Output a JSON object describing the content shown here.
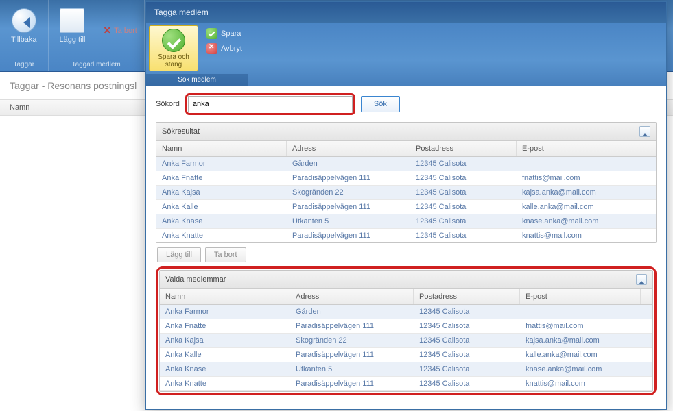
{
  "bg": {
    "back": "Tillbaka",
    "add": "Lägg till",
    "tabort": "Ta bort",
    "grp1": "Taggar",
    "grp2": "Taggad medlem",
    "breadcrumb": "Taggar - Resonans postningsl",
    "col_name": "Namn"
  },
  "modal": {
    "title": "Tagga medlem",
    "save_close": "Spara och stäng",
    "save": "Spara",
    "cancel": "Avbryt",
    "rib_label": "Sök medlem",
    "search_label": "Sökord",
    "search_value": "anka",
    "search_btn": "Sök",
    "results_title": "Sökresultat",
    "selected_title": "Valda medlemmar",
    "add_btn": "Lägg till",
    "remove_btn": "Ta bort",
    "cols": {
      "name": "Namn",
      "addr": "Adress",
      "postal": "Postadress",
      "email": "E-post"
    },
    "rows": [
      {
        "name": "Anka Farmor",
        "addr": "Gården",
        "postal": "12345 Calisota",
        "email": ""
      },
      {
        "name": "Anka Fnatte",
        "addr": "Paradisäppelvägen 111",
        "postal": "12345 Calisota",
        "email": "fnattis@mail.com"
      },
      {
        "name": "Anka Kajsa",
        "addr": "Skogränden 22",
        "postal": "12345 Calisota",
        "email": "kajsa.anka@mail.com"
      },
      {
        "name": "Anka Kalle",
        "addr": "Paradisäppelvägen 111",
        "postal": "12345 Calisota",
        "email": "kalle.anka@mail.com"
      },
      {
        "name": "Anka Knase",
        "addr": "Utkanten 5",
        "postal": "12345 Calisota",
        "email": "knase.anka@mail.com"
      },
      {
        "name": "Anka Knatte",
        "addr": "Paradisäppelvägen 111",
        "postal": "12345 Calisota",
        "email": "knattis@mail.com"
      }
    ],
    "selected_rows": [
      {
        "name": "Anka Farmor",
        "addr": "Gården",
        "postal": "12345 Calisota",
        "email": ""
      },
      {
        "name": "Anka Fnatte",
        "addr": "Paradisäppelvägen 111",
        "postal": "12345 Calisota",
        "email": "fnattis@mail.com"
      },
      {
        "name": "Anka Kajsa",
        "addr": "Skogränden 22",
        "postal": "12345 Calisota",
        "email": "kajsa.anka@mail.com"
      },
      {
        "name": "Anka Kalle",
        "addr": "Paradisäppelvägen 111",
        "postal": "12345 Calisota",
        "email": "kalle.anka@mail.com"
      },
      {
        "name": "Anka Knase",
        "addr": "Utkanten 5",
        "postal": "12345 Calisota",
        "email": "knase.anka@mail.com"
      },
      {
        "name": "Anka Knatte",
        "addr": "Paradisäppelvägen 111",
        "postal": "12345 Calisota",
        "email": "knattis@mail.com"
      }
    ]
  }
}
